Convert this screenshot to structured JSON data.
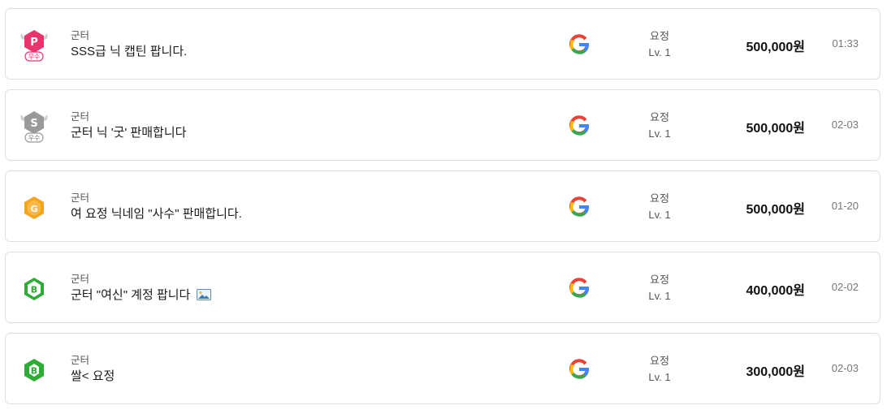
{
  "colors": {
    "badge_pink": "#e8356d",
    "badge_silver": "#9a9a9a",
    "badge_orange": "#f6a323",
    "badge_green": "#2eac37",
    "border": "#dedede"
  },
  "listings": [
    {
      "badge": "premium-excellent-badge",
      "badge_letter": "P",
      "badge_sub": "우수",
      "category": "군터",
      "title": "SSS급 닉 캡틴 팝니다.",
      "has_image": false,
      "platform_icon": "google-icon",
      "class_name": "요정",
      "level": "Lv. 1",
      "price": "500,000원",
      "date": "01:33"
    },
    {
      "badge": "silver-excellent-badge",
      "badge_letter": "S",
      "badge_sub": "우수",
      "category": "군터",
      "title": "군터 닉 '굿' 판매합니다",
      "has_image": false,
      "platform_icon": "google-icon",
      "class_name": "요정",
      "level": "Lv. 1",
      "price": "500,000원",
      "date": "02-03"
    },
    {
      "badge": "gold-badge",
      "badge_letter": "G",
      "category": "군터",
      "title": "여 요정 닉네임 \"사수\" 판매합니다.",
      "has_image": false,
      "platform_icon": "google-icon",
      "class_name": "요정",
      "level": "Lv. 1",
      "price": "500,000원",
      "date": "01-20"
    },
    {
      "badge": "bronze-badge",
      "badge_letter": "B",
      "category": "군터",
      "title": "군터 \"여신\" 계정 팝니다",
      "has_image": true,
      "platform_icon": "google-icon",
      "class_name": "요정",
      "level": "Lv. 1",
      "price": "400,000원",
      "date": "02-02"
    },
    {
      "badge": "bronze-badge",
      "badge_letter": "B",
      "category": "군터",
      "title": "쌀< 요정",
      "has_image": false,
      "platform_icon": "google-icon",
      "class_name": "요정",
      "level": "Lv. 1",
      "price": "300,000원",
      "date": "02-03"
    }
  ]
}
